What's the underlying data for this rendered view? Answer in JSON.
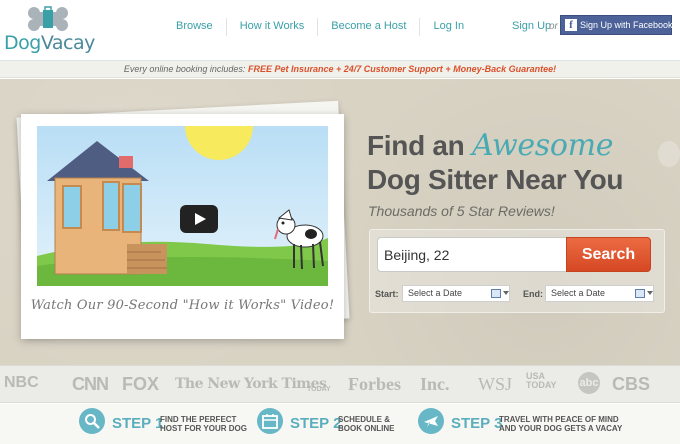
{
  "brand": {
    "name": "DogVacay",
    "name_part1": "Dog",
    "name_part2": "Vacay"
  },
  "nav": {
    "items": [
      "Browse",
      "How it Works",
      "Become a Host",
      "Log In"
    ]
  },
  "auth": {
    "signup": "Sign Up",
    "or": "or",
    "facebook": "Sign Up with Facebook",
    "facebook_icon": "f"
  },
  "promo": {
    "prefix": "Every online booking includes:",
    "item1": "FREE Pet Insurance",
    "sep": "+",
    "item2": "24/7 Customer Support",
    "item3": "Money-Back Guarantee!"
  },
  "video": {
    "caption": "Watch Our 90-Second \"How it Works\" Video!"
  },
  "hero": {
    "line1_a": "Find an",
    "line1_b": "Awesome",
    "line2": "Dog Sitter Near You",
    "subhead": "Thousands of 5 Star Reviews!"
  },
  "search": {
    "value": "Beijing, 22",
    "button": "Search",
    "start_label": "Start:",
    "start_placeholder": "Select a Date",
    "end_label": "End:",
    "end_placeholder": "Select a Date"
  },
  "press": [
    "NBC",
    "CNN",
    "FOX",
    "The New York Times",
    "TODAY",
    "Forbes",
    "Inc.",
    "WSJ",
    "USA TODAY",
    "abc",
    "CBS"
  ],
  "steps": [
    {
      "title": "STEP 1",
      "desc1": "Find the perfect",
      "desc2": "host for your dog",
      "icon": "search-icon"
    },
    {
      "title": "STEP 2",
      "desc1": "Schedule &",
      "desc2": "book online",
      "icon": "calendar-icon"
    },
    {
      "title": "STEP 3",
      "desc1": "Travel with peace of mind",
      "desc2": "and your dog gets a vacay",
      "icon": "airplane-icon"
    }
  ],
  "colors": {
    "teal": "#3aa0a8",
    "orange": "#e0532d",
    "facebook": "#4c6298",
    "promo_red": "#d9502a"
  }
}
